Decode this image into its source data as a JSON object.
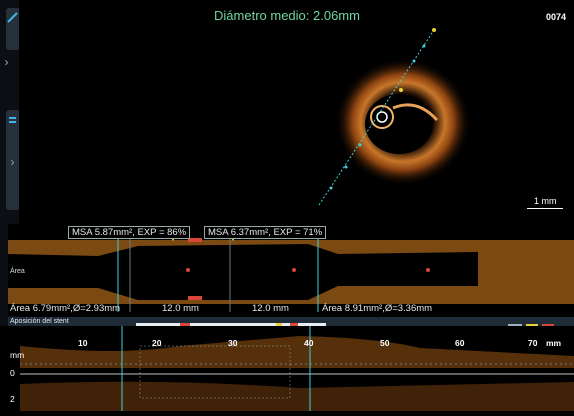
{
  "header": {
    "title": "Diámetro medio: 2.06mm",
    "frame_number": "0074",
    "scale_label": "1 mm"
  },
  "area_panel": {
    "label": "Área",
    "msa_left": "MSA 5.87mm², EXP = 86%",
    "msa_right": "MSA 6.37mm², EXP = 71%",
    "ref_left": "Área 6.79mm²,Ø=2.93mm",
    "len_left": "12.0 mm",
    "len_right": "12.0 mm",
    "ref_right": "Área 8.91mm²,Ø=3.36mm"
  },
  "apposition": {
    "label": "Aposición del stent"
  },
  "profile": {
    "unit_label": "mm",
    "x_ticks": [
      "10",
      "20",
      "30",
      "40",
      "50",
      "60",
      "70"
    ],
    "x_unit": "mm",
    "y_ticks": [
      "0",
      "2"
    ]
  },
  "colors": {
    "title": "#6fd4a0",
    "tissue": "#c8762a",
    "stent_marker": "#d8463a",
    "marker_yellow": "#e8d23a",
    "guide_line": "#3fd0d8"
  },
  "icons": {
    "side_pen": "pen-icon",
    "side_chevron": "chevron-right-icon"
  }
}
